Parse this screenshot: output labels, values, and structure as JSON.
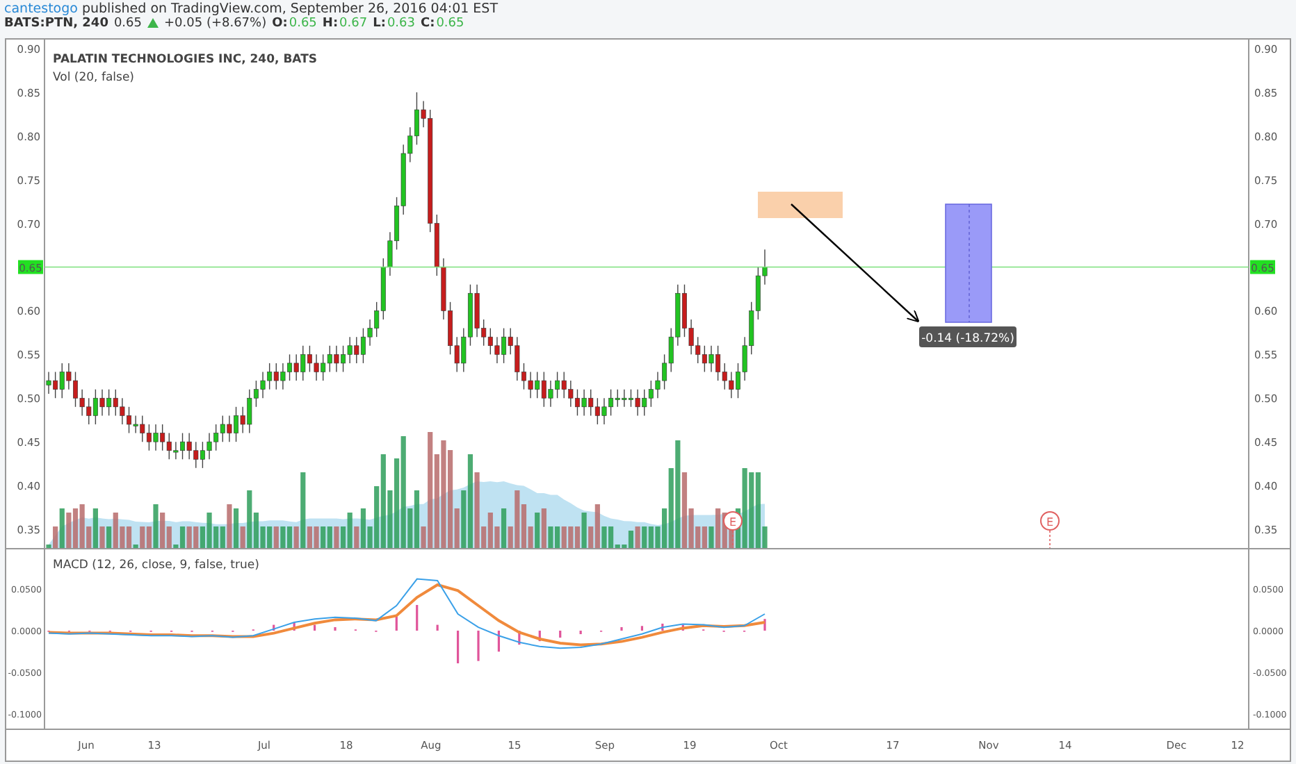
{
  "header": {
    "author": "cantestogo",
    "published": "published on TradingView.com, September 26, 2016 04:01 EST"
  },
  "quote": {
    "symbol": "BATS:PTN, 240",
    "last": "0.65",
    "change": "+0.05 (+8.67%)",
    "ohlc": [
      {
        "label": "O:",
        "value": "0.65"
      },
      {
        "label": "H:",
        "value": "0.67"
      },
      {
        "label": "L:",
        "value": "0.63"
      },
      {
        "label": "C:",
        "value": "0.65"
      }
    ]
  },
  "price_pane": {
    "title": "PALATIN TECHNOLOGIES INC, 240, BATS",
    "volume_label": "Vol (20, false)",
    "right_axis": [
      "0.90",
      "0.85",
      "0.80",
      "0.75",
      "0.70",
      "0.60",
      "0.55",
      "0.50",
      "0.45",
      "0.40",
      "0.35"
    ],
    "left_price_badge": "0.65",
    "right_price_badge": "0.65",
    "measure_label": "-0.14 (-18.72%)",
    "events": [
      {
        "label": "E"
      },
      {
        "label": "E"
      }
    ],
    "chart_data": {
      "type": "candlestick",
      "categories": [
        null,
        null,
        null,
        null,
        null,
        null,
        null,
        null,
        null,
        null,
        null,
        null,
        null,
        null,
        null,
        null,
        null,
        null,
        null,
        null,
        null,
        null,
        null,
        null,
        null,
        null,
        null,
        null,
        null,
        null,
        null,
        null,
        null,
        null,
        null,
        null,
        null,
        null,
        null,
        null,
        null,
        null,
        null,
        null,
        null,
        null,
        null,
        null,
        null,
        null,
        null,
        null,
        null,
        null,
        null,
        null,
        null,
        null,
        null,
        null,
        null,
        null,
        null,
        null,
        null,
        null,
        null,
        null,
        null,
        null,
        null,
        null,
        null,
        null,
        null,
        null,
        null,
        null,
        null,
        null,
        null,
        null,
        null,
        null,
        null,
        null,
        null,
        null,
        null,
        null,
        null,
        null,
        null,
        null,
        null,
        null,
        null,
        null,
        null,
        null,
        null,
        null,
        null,
        null,
        null,
        null,
        null,
        null
      ],
      "ylim": [
        0.3277,
        0.9111
      ],
      "yticks": [
        {
          "value": 0.9,
          "label": "0.90"
        },
        {
          "value": 0.85,
          "label": "0.85"
        },
        {
          "value": 0.8,
          "label": "0.80"
        },
        {
          "value": 0.75,
          "label": "0.75"
        },
        {
          "value": 0.7,
          "label": "0.70"
        },
        {
          "value": 0.6,
          "label": "0.60"
        },
        {
          "value": 0.55,
          "label": "0.55"
        },
        {
          "value": 0.5,
          "label": "0.50"
        },
        {
          "value": 0.45,
          "label": "0.45"
        },
        {
          "value": 0.4,
          "label": "0.40"
        },
        {
          "value": 0.35,
          "label": "0.35"
        }
      ],
      "ohlc": [
        [
          0.515,
          0.53,
          0.505,
          0.52
        ],
        [
          0.52,
          0.53,
          0.5,
          0.51
        ],
        [
          0.51,
          0.54,
          0.5,
          0.53
        ],
        [
          0.53,
          0.54,
          0.51,
          0.52
        ],
        [
          0.52,
          0.53,
          0.49,
          0.5
        ],
        [
          0.5,
          0.51,
          0.48,
          0.49
        ],
        [
          0.49,
          0.5,
          0.47,
          0.48
        ],
        [
          0.48,
          0.51,
          0.47,
          0.5
        ],
        [
          0.5,
          0.51,
          0.48,
          0.49
        ],
        [
          0.49,
          0.51,
          0.48,
          0.5
        ],
        [
          0.5,
          0.51,
          0.48,
          0.49
        ],
        [
          0.49,
          0.5,
          0.47,
          0.48
        ],
        [
          0.48,
          0.49,
          0.46,
          0.47
        ],
        [
          0.47,
          0.48,
          0.46,
          0.47
        ],
        [
          0.47,
          0.48,
          0.45,
          0.46
        ],
        [
          0.46,
          0.47,
          0.44,
          0.45
        ],
        [
          0.45,
          0.47,
          0.44,
          0.46
        ],
        [
          0.46,
          0.47,
          0.44,
          0.45
        ],
        [
          0.45,
          0.46,
          0.43,
          0.44
        ],
        [
          0.44,
          0.45,
          0.43,
          0.44
        ],
        [
          0.44,
          0.46,
          0.43,
          0.45
        ],
        [
          0.45,
          0.46,
          0.43,
          0.44
        ],
        [
          0.44,
          0.45,
          0.42,
          0.43
        ],
        [
          0.43,
          0.45,
          0.42,
          0.44
        ],
        [
          0.44,
          0.46,
          0.43,
          0.45
        ],
        [
          0.45,
          0.47,
          0.44,
          0.46
        ],
        [
          0.46,
          0.48,
          0.45,
          0.47
        ],
        [
          0.47,
          0.48,
          0.45,
          0.46
        ],
        [
          0.46,
          0.49,
          0.45,
          0.48
        ],
        [
          0.48,
          0.49,
          0.46,
          0.47
        ],
        [
          0.47,
          0.51,
          0.46,
          0.5
        ],
        [
          0.5,
          0.52,
          0.49,
          0.51
        ],
        [
          0.51,
          0.53,
          0.5,
          0.52
        ],
        [
          0.52,
          0.54,
          0.51,
          0.53
        ],
        [
          0.53,
          0.54,
          0.51,
          0.52
        ],
        [
          0.52,
          0.54,
          0.51,
          0.53
        ],
        [
          0.53,
          0.55,
          0.52,
          0.54
        ],
        [
          0.54,
          0.55,
          0.52,
          0.53
        ],
        [
          0.53,
          0.56,
          0.52,
          0.55
        ],
        [
          0.55,
          0.56,
          0.53,
          0.54
        ],
        [
          0.54,
          0.55,
          0.52,
          0.53
        ],
        [
          0.53,
          0.55,
          0.52,
          0.54
        ],
        [
          0.54,
          0.56,
          0.53,
          0.55
        ],
        [
          0.55,
          0.56,
          0.53,
          0.54
        ],
        [
          0.54,
          0.56,
          0.53,
          0.55
        ],
        [
          0.55,
          0.57,
          0.54,
          0.56
        ],
        [
          0.56,
          0.57,
          0.54,
          0.55
        ],
        [
          0.55,
          0.58,
          0.54,
          0.57
        ],
        [
          0.57,
          0.59,
          0.56,
          0.58
        ],
        [
          0.58,
          0.61,
          0.57,
          0.6
        ],
        [
          0.6,
          0.66,
          0.59,
          0.65
        ],
        [
          0.65,
          0.69,
          0.64,
          0.68
        ],
        [
          0.68,
          0.73,
          0.67,
          0.72
        ],
        [
          0.72,
          0.79,
          0.71,
          0.78
        ],
        [
          0.78,
          0.81,
          0.77,
          0.8
        ],
        [
          0.8,
          0.85,
          0.79,
          0.83
        ],
        [
          0.83,
          0.84,
          0.81,
          0.82
        ],
        [
          0.82,
          0.83,
          0.69,
          0.7
        ],
        [
          0.7,
          0.71,
          0.64,
          0.65
        ],
        [
          0.65,
          0.66,
          0.59,
          0.6
        ],
        [
          0.6,
          0.61,
          0.55,
          0.56
        ],
        [
          0.56,
          0.57,
          0.53,
          0.54
        ],
        [
          0.54,
          0.58,
          0.53,
          0.57
        ],
        [
          0.57,
          0.63,
          0.56,
          0.62
        ],
        [
          0.62,
          0.63,
          0.57,
          0.58
        ],
        [
          0.58,
          0.59,
          0.56,
          0.57
        ],
        [
          0.57,
          0.58,
          0.55,
          0.56
        ],
        [
          0.56,
          0.57,
          0.54,
          0.55
        ],
        [
          0.55,
          0.58,
          0.54,
          0.57
        ],
        [
          0.57,
          0.58,
          0.55,
          0.56
        ],
        [
          0.56,
          0.57,
          0.52,
          0.53
        ],
        [
          0.53,
          0.54,
          0.51,
          0.52
        ],
        [
          0.52,
          0.53,
          0.5,
          0.51
        ],
        [
          0.51,
          0.53,
          0.5,
          0.52
        ],
        [
          0.52,
          0.53,
          0.49,
          0.5
        ],
        [
          0.5,
          0.52,
          0.49,
          0.51
        ],
        [
          0.51,
          0.53,
          0.5,
          0.52
        ],
        [
          0.52,
          0.53,
          0.5,
          0.51
        ],
        [
          0.51,
          0.52,
          0.49,
          0.5
        ],
        [
          0.5,
          0.51,
          0.48,
          0.49
        ],
        [
          0.49,
          0.51,
          0.48,
          0.5
        ],
        [
          0.5,
          0.51,
          0.48,
          0.49
        ],
        [
          0.49,
          0.5,
          0.47,
          0.48
        ],
        [
          0.48,
          0.5,
          0.47,
          0.49
        ],
        [
          0.49,
          0.51,
          0.48,
          0.5
        ],
        [
          0.5,
          0.51,
          0.49,
          0.5
        ],
        [
          0.5,
          0.51,
          0.49,
          0.5
        ],
        [
          0.5,
          0.51,
          0.49,
          0.5
        ],
        [
          0.5,
          0.51,
          0.48,
          0.49
        ],
        [
          0.49,
          0.51,
          0.48,
          0.5
        ],
        [
          0.5,
          0.52,
          0.49,
          0.51
        ],
        [
          0.51,
          0.53,
          0.5,
          0.52
        ],
        [
          0.52,
          0.55,
          0.51,
          0.54
        ],
        [
          0.54,
          0.58,
          0.53,
          0.57
        ],
        [
          0.57,
          0.63,
          0.56,
          0.62
        ],
        [
          0.62,
          0.63,
          0.57,
          0.58
        ],
        [
          0.58,
          0.59,
          0.55,
          0.56
        ],
        [
          0.56,
          0.57,
          0.54,
          0.55
        ],
        [
          0.55,
          0.56,
          0.53,
          0.54
        ],
        [
          0.54,
          0.56,
          0.53,
          0.55
        ],
        [
          0.55,
          0.56,
          0.52,
          0.53
        ],
        [
          0.53,
          0.54,
          0.51,
          0.52
        ],
        [
          0.52,
          0.53,
          0.5,
          0.51
        ],
        [
          0.51,
          0.54,
          0.5,
          0.53
        ],
        [
          0.53,
          0.57,
          0.52,
          0.56
        ],
        [
          0.56,
          0.61,
          0.55,
          0.6
        ],
        [
          0.6,
          0.65,
          0.59,
          0.64
        ],
        [
          0.64,
          0.67,
          0.63,
          0.65
        ]
      ]
    }
  },
  "macd_pane": {
    "title": "MACD (12, 26, close, 9, false, true)",
    "right_axis": [
      "0.0500",
      "0.0000",
      "-0.0500",
      "-0.1000"
    ],
    "chart_data": {
      "type": "line",
      "categories": [
        null,
        null,
        null,
        null,
        null,
        null,
        null,
        null,
        null,
        null,
        null,
        null,
        null,
        null,
        null,
        null,
        null,
        null,
        null,
        null,
        null,
        null,
        null,
        null,
        null,
        null,
        null,
        null,
        null,
        null,
        null,
        null,
        null,
        null,
        null,
        null
      ],
      "ylim": [
        -0.1183,
        0.0983
      ],
      "yticks": [
        {
          "value": 0.05,
          "label": "0.0500"
        },
        {
          "value": 0,
          "label": "0.0000"
        },
        {
          "value": -0.05,
          "label": "-0.0500"
        },
        {
          "value": -0.1,
          "label": "-0.1000"
        }
      ],
      "series": [
        {
          "color": "#3aa0e8",
          "values": [
            -0.003,
            -0.004,
            -0.003,
            -0.004,
            -0.005,
            -0.006,
            -0.006,
            -0.007,
            -0.006,
            -0.008,
            -0.006,
            0.002,
            0.01,
            0.014,
            0.016,
            0.015,
            0.012,
            0.03,
            0.062,
            0.06,
            0.02,
            0.004,
            -0.006,
            -0.014,
            -0.019,
            -0.021,
            -0.02,
            -0.016,
            -0.01,
            -0.004,
            0.004,
            0.008,
            0.007,
            0.004,
            0.006,
            0.02
          ]
        },
        {
          "color": "#f08a3c",
          "values": [
            -0.002,
            -0.003,
            -0.003,
            -0.003,
            -0.004,
            -0.005,
            -0.005,
            -0.006,
            -0.006,
            -0.007,
            -0.007,
            -0.003,
            0.003,
            0.009,
            0.013,
            0.014,
            0.013,
            0.018,
            0.04,
            0.055,
            0.048,
            0.03,
            0.012,
            -0.002,
            -0.01,
            -0.015,
            -0.017,
            -0.016,
            -0.013,
            -0.008,
            -0.002,
            0.003,
            0.006,
            0.005,
            0.006,
            0.01
          ]
        }
      ]
    }
  },
  "time_axis": [
    "Jun",
    "13",
    "Jul",
    "18",
    "Aug",
    "15",
    "Sep",
    "19",
    "Oct",
    "17",
    "Nov",
    "14",
    "Dec",
    "12"
  ]
}
